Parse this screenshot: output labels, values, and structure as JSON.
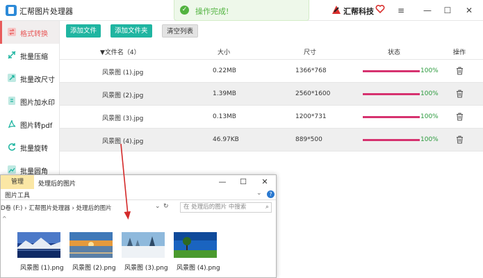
{
  "app": {
    "title": "汇帮图片处理器"
  },
  "toast": {
    "message": "操作完成!"
  },
  "brand": {
    "name": "汇帮科技"
  },
  "window_controls": {
    "menu": "≡",
    "minimize": "—",
    "maximize": "☐",
    "close": "✕"
  },
  "sidebar": {
    "items": [
      {
        "label": "格式转换",
        "icon": "format-convert-icon",
        "active": true
      },
      {
        "label": "批量压缩",
        "icon": "compress-icon"
      },
      {
        "label": "批量改尺寸",
        "icon": "resize-icon"
      },
      {
        "label": "图片加水印",
        "icon": "watermark-icon"
      },
      {
        "label": "图片转pdf",
        "icon": "pdf-icon"
      },
      {
        "label": "批量旋转",
        "icon": "rotate-icon"
      },
      {
        "label": "批量圆角",
        "icon": "round-corner-icon"
      }
    ]
  },
  "toolbar": {
    "add_file": "添加文件",
    "add_folder": "添加文件夹",
    "clear_list": "清空列表"
  },
  "table": {
    "headers": {
      "name": "▼文件名（4）",
      "size": "大小",
      "dimensions": "尺寸",
      "status": "状态",
      "actions": "操作"
    },
    "rows": [
      {
        "name": "风景图 (1).jpg",
        "size": "0.22MB",
        "dims": "1366*768",
        "progress": 100,
        "pct": "100%"
      },
      {
        "name": "风景图 (2).jpg",
        "size": "1.39MB",
        "dims": "2560*1600",
        "progress": 100,
        "pct": "100%"
      },
      {
        "name": "风景图 (3).jpg",
        "size": "0.13MB",
        "dims": "1200*731",
        "progress": 100,
        "pct": "100%"
      },
      {
        "name": "风景图 (4).jpg",
        "size": "46.97KB",
        "dims": "889*500",
        "progress": 100,
        "pct": "100%"
      }
    ]
  },
  "explorer": {
    "manage_tab": "管理",
    "title": "处理后的图片",
    "ribbon_tab": "图片工具",
    "path": "D卷 (F:)  ›  汇帮图片处理器  ›  处理后的图片",
    "search_placeholder": "在 处理后的图片 中搜索",
    "files": [
      {
        "name": "风景图 (1).png"
      },
      {
        "name": "风景图 (2).png"
      },
      {
        "name": "风景图 (3).png"
      },
      {
        "name": "风景图 (4).png"
      }
    ]
  },
  "colors": {
    "accent": "#1fb5a1",
    "active": "#e85a5a",
    "progress": "#d6326f",
    "success": "#2a9a3c"
  }
}
